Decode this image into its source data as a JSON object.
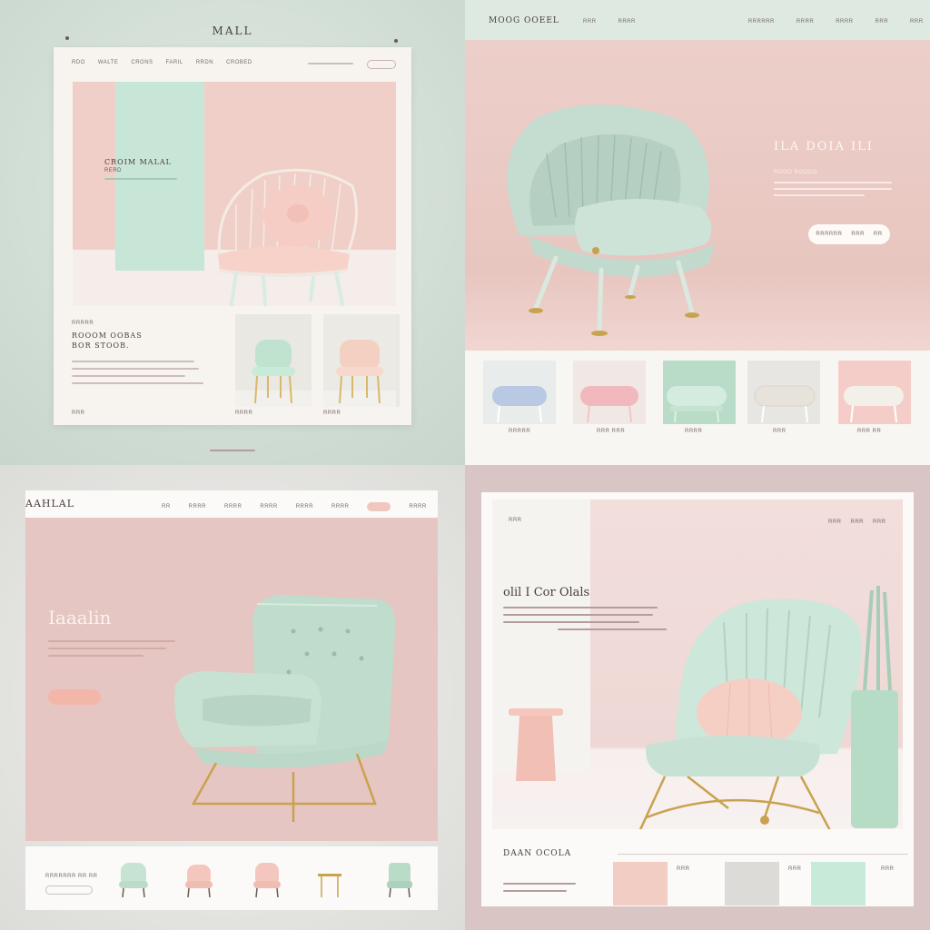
{
  "q1": {
    "brand": "MALL",
    "nav": [
      "RDO",
      "WALTE",
      "CRONS",
      "FARIL",
      "RRDN",
      "CROBED"
    ],
    "hero_title": "CROIM MALAL",
    "hero_sub": "RERD",
    "section_label": "RRRRR",
    "heading_line1": "ROOOM OOBAS",
    "heading_line2": "BOR STOOB.",
    "more": "RRR",
    "cards": [
      {
        "label": "RRRR",
        "color": "#bfe3cf"
      },
      {
        "label": "RRRR",
        "color": "#f4d0c2"
      }
    ]
  },
  "q2": {
    "brand": "MOOG OOEEL",
    "nav": [
      "RRR",
      "RRRR",
      "RRRRRR",
      "RRRR",
      "RRRR",
      "RRR",
      "RRR"
    ],
    "title": "ILA DOIA ILI",
    "sub": "ROOO ROOOO",
    "cta": [
      "RRRRRR",
      "RRR",
      "RR"
    ],
    "products": [
      {
        "label": "RRRRR",
        "bg": "#e8ecea",
        "seat": "#b9c9e3"
      },
      {
        "label": "RRR RRR",
        "bg": "#f1e8e5",
        "seat": "#f1b8bd"
      },
      {
        "label": "RRRR",
        "bg": "#b8dcc8",
        "seat": "#d4ece0"
      },
      {
        "label": "RRR",
        "bg": "#e7e6e3",
        "seat": "#e7e2da"
      },
      {
        "label": "RRR RR",
        "bg": "#f5cdc8",
        "seat": "#f3efe9"
      }
    ]
  },
  "q3": {
    "brand": "AAHLAL",
    "nav": [
      "RR",
      "RRRR",
      "RRRR",
      "RRRR",
      "RRRR",
      "RRRR",
      "RRRR"
    ],
    "title": "Iaaalin",
    "bottom_label": "RRRRRRR RR RR"
  },
  "q4": {
    "hero_label": "RRR",
    "nav": [
      "RRR",
      "RRR",
      "RRR"
    ],
    "heading": "olil I Cor Olals",
    "bottom_title": "DAAN OCOLA",
    "swatches": [
      {
        "color": "#f2cdc4",
        "label_a": "RRR"
      },
      {
        "color": "#dcdbd8",
        "label_a": "RRR"
      },
      {
        "color": "#c8ead8",
        "label_a": "RRR"
      }
    ]
  }
}
